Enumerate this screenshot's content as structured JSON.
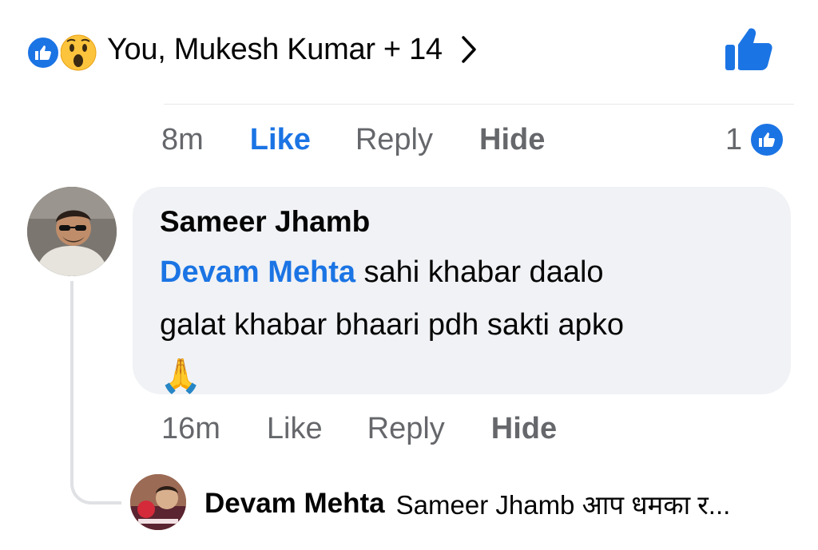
{
  "reactions": {
    "summary": "You, Mukesh Kumar + 14",
    "icons": [
      "like-icon",
      "wow-icon"
    ]
  },
  "top_comment_actions": {
    "time": "8m",
    "like": "Like",
    "reply": "Reply",
    "hide": "Hide",
    "like_count": "1"
  },
  "comment": {
    "author": "Sameer Jhamb",
    "mention": "Devam Mehta",
    "text_line1": " sahi khabar daalo",
    "text_line2": "galat khabar bhaari pdh sakti apko",
    "emoji": "🙏",
    "actions": {
      "time": "16m",
      "like": "Like",
      "reply": "Reply",
      "hide": "Hide"
    }
  },
  "reply": {
    "author": "Devam Mehta",
    "preview": "Sameer Jhamb आप धमका र..."
  },
  "colors": {
    "accent": "#1b74e4",
    "muted": "#65676b",
    "bubble": "#f0f2f5"
  }
}
